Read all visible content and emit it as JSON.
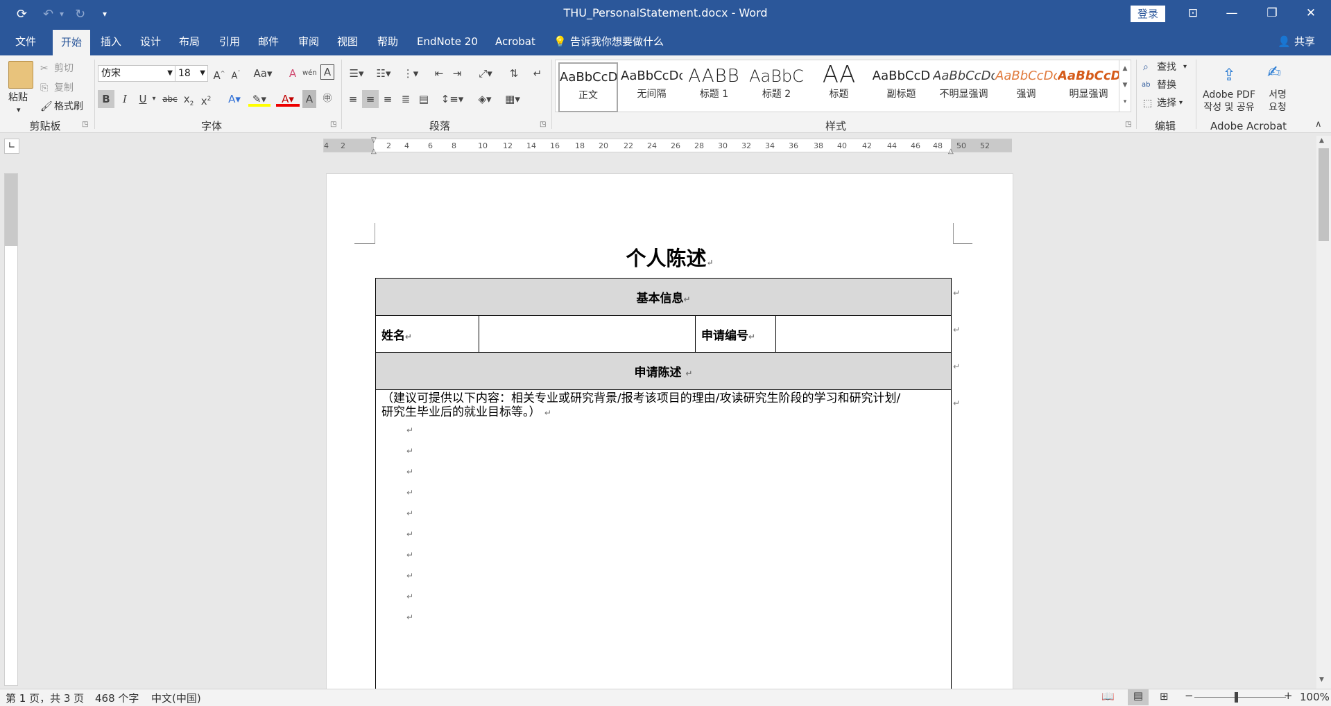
{
  "window": {
    "doc_title": "THU_PersonalStatement.docx  -  Word",
    "login_label": "登录",
    "undo_icon": "undo-icon",
    "save_icon": "autosave-icon"
  },
  "menu": {
    "items": [
      "文件",
      "开始",
      "插入",
      "设计",
      "布局",
      "引用",
      "邮件",
      "审阅",
      "视图",
      "帮助",
      "EndNote 20",
      "Acrobat"
    ],
    "tell_me": "告诉我你想要做什么",
    "share": "共享"
  },
  "ribbon": {
    "clipboard": {
      "paste": "粘贴",
      "cut": "剪切",
      "copy": "复制",
      "format_painter": "格式刷",
      "label": "剪贴板"
    },
    "font": {
      "name": "仿宋",
      "size": "18",
      "label": "字体"
    },
    "paragraph": {
      "label": "段落"
    },
    "styles": {
      "label": "样式",
      "items": [
        {
          "preview": "AaBbCcDc",
          "name": "正文"
        },
        {
          "preview": "AaBbCcDc",
          "name": "无间隔"
        },
        {
          "preview": "AABB",
          "name": "标题 1"
        },
        {
          "preview": "AaBbC",
          "name": "标题 2"
        },
        {
          "preview": "AA",
          "name": "标题"
        },
        {
          "preview": "AaBbCcD",
          "name": "副标题"
        },
        {
          "preview": "AaBbCcDc",
          "name": "不明显强调"
        },
        {
          "preview": "AaBbCcDc",
          "name": "强调"
        },
        {
          "preview": "AaBbCcDc",
          "name": "明显强调"
        }
      ]
    },
    "editing": {
      "find": "查找",
      "replace": "替换",
      "select": "选择",
      "label": "编辑"
    },
    "acrobat": {
      "create_pdf_1": "Adobe PDF",
      "create_pdf_2": "작성 및 공유",
      "sign_1": "서명",
      "sign_2": "요청",
      "label": "Adobe Acrobat"
    }
  },
  "ruler": {
    "labels": [
      "4",
      "2",
      "2",
      "4",
      "6",
      "8",
      "10",
      "12",
      "14",
      "16",
      "18",
      "20",
      "22",
      "24",
      "26",
      "28",
      "30",
      "32",
      "34",
      "36",
      "38",
      "40",
      "42",
      "44",
      "46",
      "48",
      "50",
      "52"
    ]
  },
  "document": {
    "title": "个人陈述",
    "basic_info": "基本信息",
    "name_label": "姓名",
    "app_no_label": "申请编号",
    "statement_header": "申请陈述",
    "statement_hint_1": "（建议可提供以下内容：相关专业或研究背景/报考该项目的理由/攻读研究生阶段的学习和研究计划/",
    "statement_hint_2": "研究生毕业后的就业目标等。）"
  },
  "status": {
    "page": "第 1 页，共 3 页",
    "words": "468 个字",
    "lang": "中文(中国)",
    "zoom": "100%"
  }
}
